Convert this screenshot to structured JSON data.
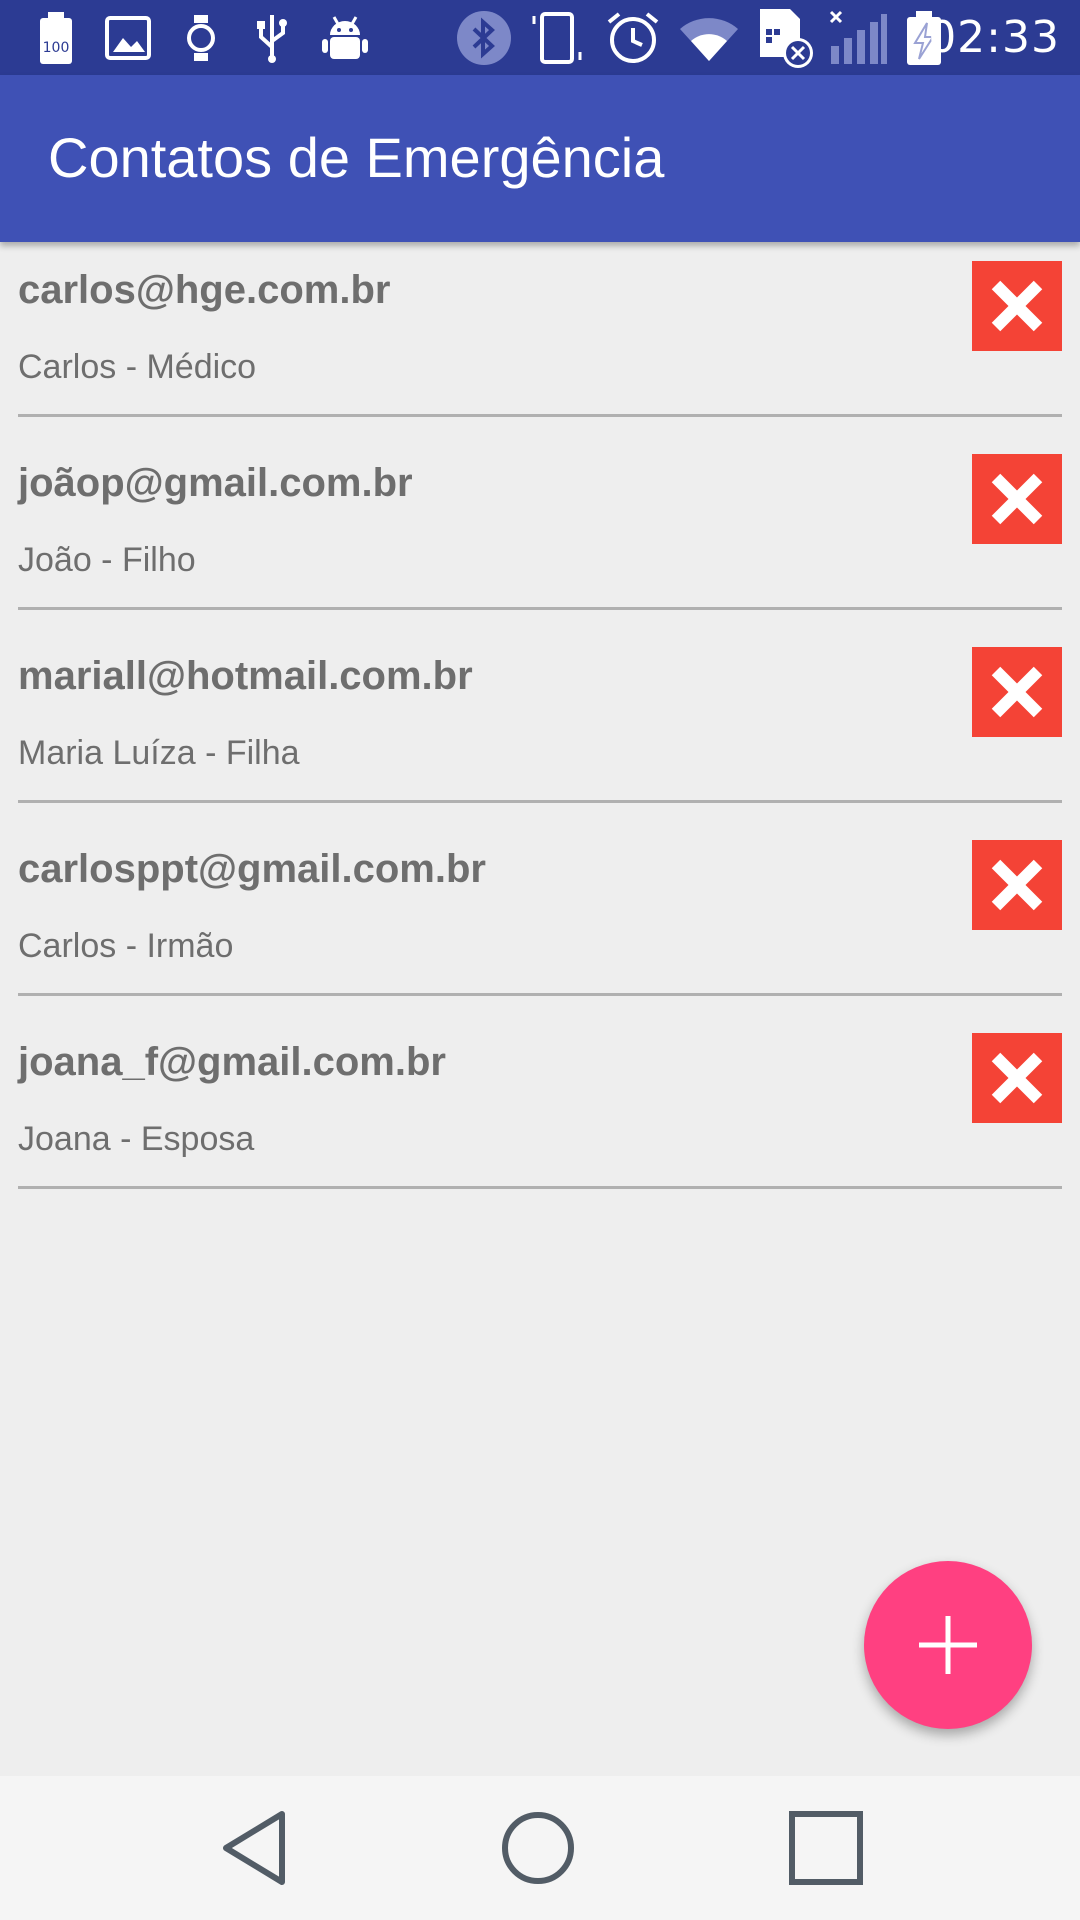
{
  "status_bar": {
    "time": "02:33",
    "battery_level_label": "100",
    "icons": [
      "battery-100-icon",
      "image-icon",
      "watch-icon",
      "usb-icon",
      "android-debug-icon",
      "bluetooth-icon",
      "vibrate-icon",
      "alarm-icon",
      "wifi-icon",
      "sim-error-icon",
      "signal-icon",
      "battery-charging-icon"
    ]
  },
  "app_bar": {
    "title": "Contatos de Emergência"
  },
  "contacts": [
    {
      "email": "carlos@hge.com.br",
      "description": "Carlos - Médico"
    },
    {
      "email": "joãop@gmail.com.br",
      "description": "João - Filho"
    },
    {
      "email": "mariall@hotmail.com.br",
      "description": "Maria Luíza - Filha"
    },
    {
      "email": "carlosppt@gmail.com.br",
      "description": "Carlos - Irmão"
    },
    {
      "email": "joana_f@gmail.com.br",
      "description": "Joana - Esposa"
    }
  ],
  "colors": {
    "status_bar": "#2c3b93",
    "app_bar": "#3f51b5",
    "delete_button": "#f44336",
    "fab": "#ff4081",
    "background": "#eeeeee",
    "text": "#6e6e6e"
  },
  "fab": {
    "icon": "plus-icon"
  },
  "nav_bar": {
    "icons": [
      "back-icon",
      "home-icon",
      "recents-icon"
    ]
  }
}
